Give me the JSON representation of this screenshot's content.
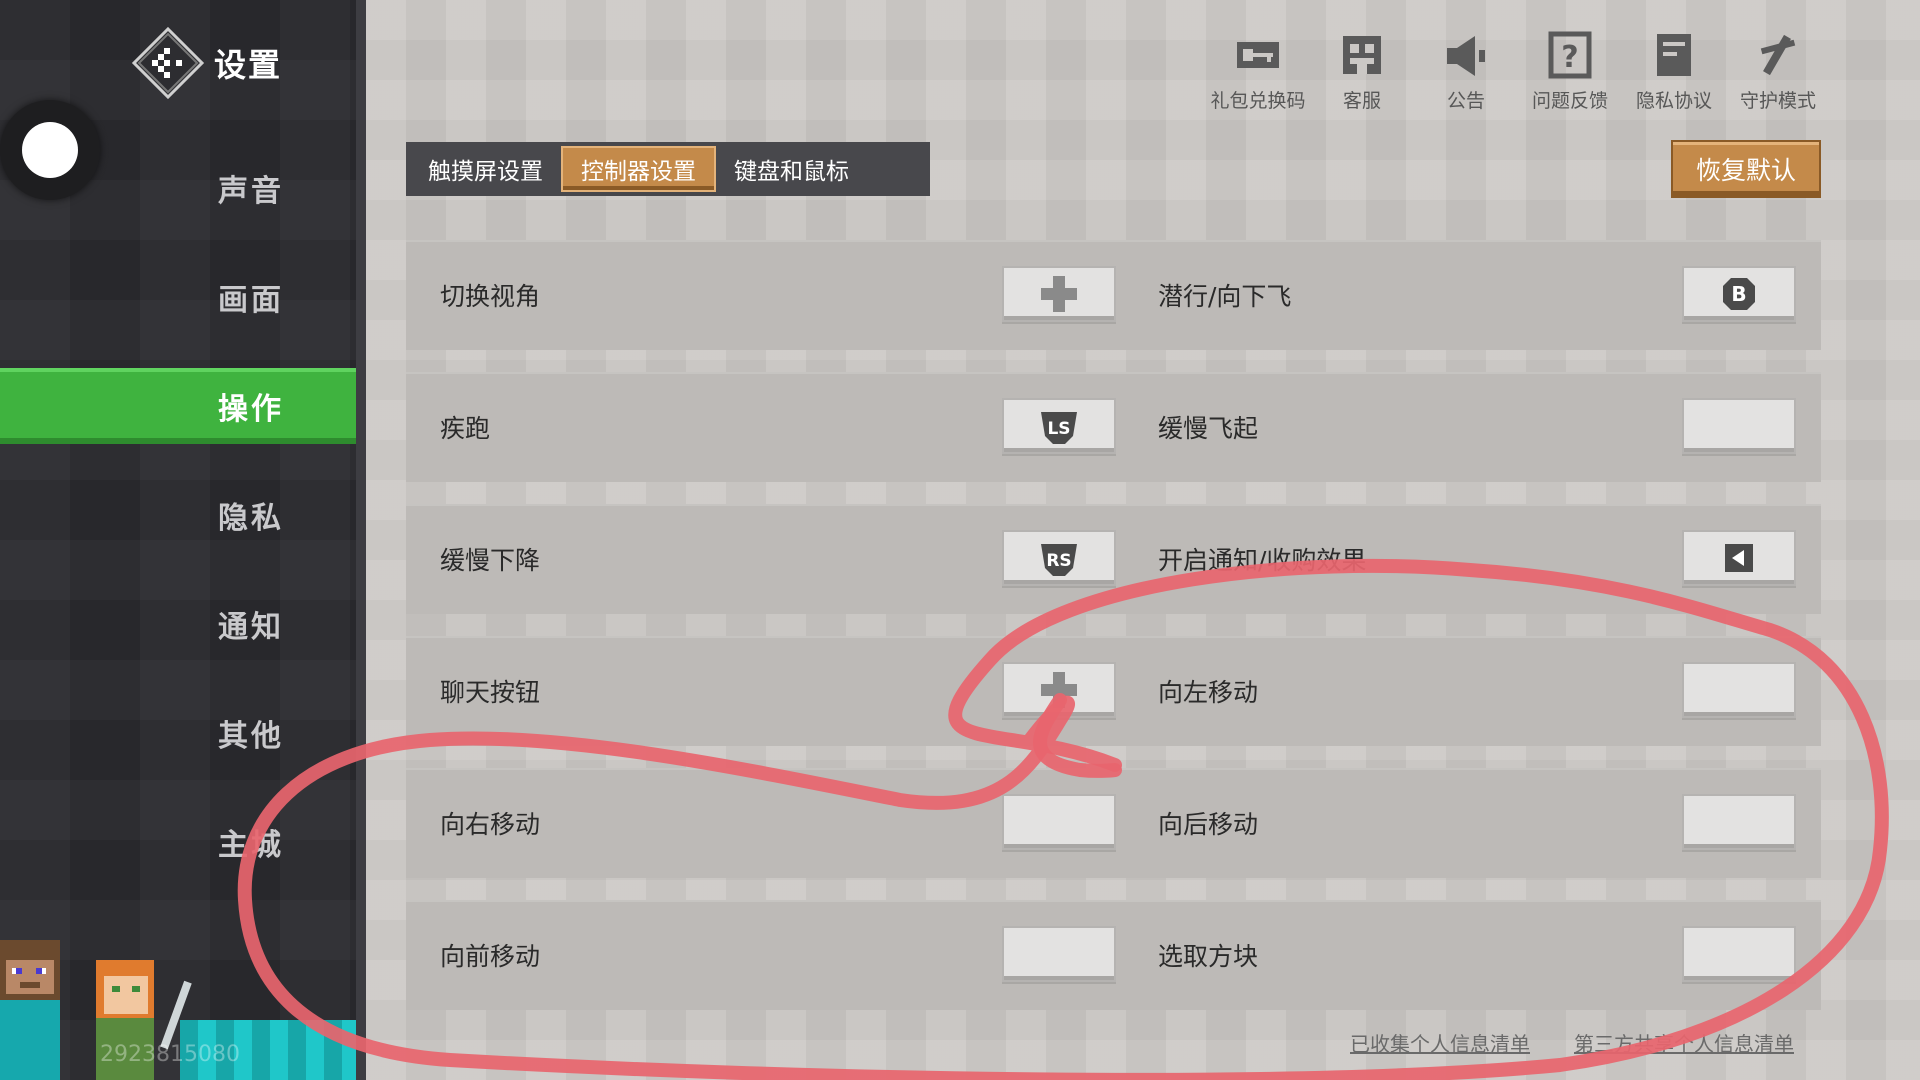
{
  "sidebar": {
    "title": "设置",
    "items": [
      {
        "label": "声音"
      },
      {
        "label": "画面"
      },
      {
        "label": "操作",
        "active": true
      },
      {
        "label": "隐私"
      },
      {
        "label": "通知"
      },
      {
        "label": "其他"
      },
      {
        "label": "主城"
      }
    ],
    "uid": "2923815080"
  },
  "top_icons": [
    {
      "label": "礼包兑换码",
      "icon": "key-icon"
    },
    {
      "label": "客服",
      "icon": "support-icon"
    },
    {
      "label": "公告",
      "icon": "megaphone-icon"
    },
    {
      "label": "问题反馈",
      "icon": "question-icon"
    },
    {
      "label": "隐私协议",
      "icon": "document-icon"
    },
    {
      "label": "守护模式",
      "icon": "guard-icon"
    }
  ],
  "tabs": [
    {
      "label": "触摸屏设置"
    },
    {
      "label": "控制器设置",
      "active": true
    },
    {
      "label": "键盘和鼠标"
    }
  ],
  "restore_label": "恢复默认",
  "rows": [
    {
      "left": {
        "label": "切换视角",
        "binding": "dpad-icon"
      },
      "right": {
        "label": "潜行/向下飞",
        "binding": "b-button-icon"
      }
    },
    {
      "left": {
        "label": "疾跑",
        "binding": "ls-icon"
      },
      "right": {
        "label": "缓慢飞起",
        "binding": ""
      }
    },
    {
      "left": {
        "label": "缓慢下降",
        "binding": "rs-icon"
      },
      "right": {
        "label": "开启通知/收购效果",
        "binding": "dpad-left-icon"
      }
    },
    {
      "left": {
        "label": "聊天按钮",
        "binding": "dpad-icon"
      },
      "right": {
        "label": "向左移动",
        "binding": ""
      }
    },
    {
      "left": {
        "label": "向右移动",
        "binding": ""
      },
      "right": {
        "label": "向后移动",
        "binding": ""
      }
    },
    {
      "left": {
        "label": "向前移动",
        "binding": ""
      },
      "right": {
        "label": "选取方块",
        "binding": ""
      }
    }
  ],
  "footer": {
    "collected_info": "已收集个人信息清单",
    "third_party": "第三方共享个人信息清单"
  },
  "colors": {
    "active_green": "#3fb33f",
    "accent_orange": "#c48a4a",
    "annotation_red": "#e8656e"
  }
}
